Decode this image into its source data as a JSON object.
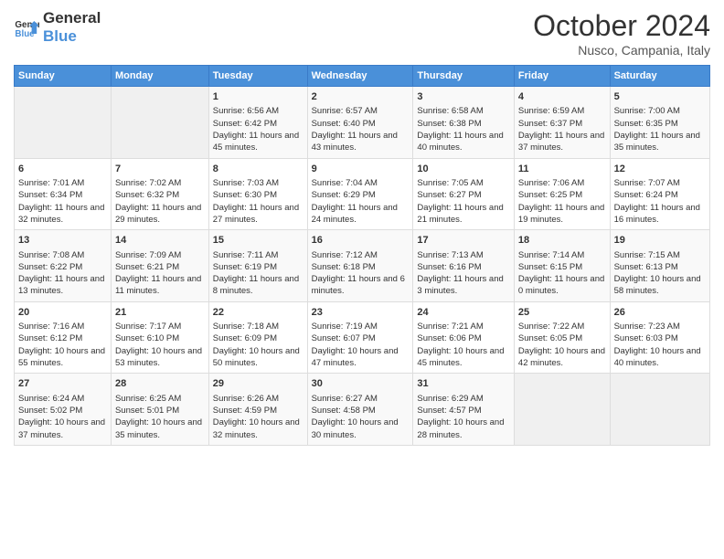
{
  "header": {
    "logo_line1": "General",
    "logo_line2": "Blue",
    "month": "October 2024",
    "location": "Nusco, Campania, Italy"
  },
  "weekdays": [
    "Sunday",
    "Monday",
    "Tuesday",
    "Wednesday",
    "Thursday",
    "Friday",
    "Saturday"
  ],
  "weeks": [
    [
      {
        "day": "",
        "sunrise": "",
        "sunset": "",
        "daylight": "",
        "empty": true
      },
      {
        "day": "",
        "sunrise": "",
        "sunset": "",
        "daylight": "",
        "empty": true
      },
      {
        "day": "1",
        "sunrise": "Sunrise: 6:56 AM",
        "sunset": "Sunset: 6:42 PM",
        "daylight": "Daylight: 11 hours and 45 minutes.",
        "empty": false
      },
      {
        "day": "2",
        "sunrise": "Sunrise: 6:57 AM",
        "sunset": "Sunset: 6:40 PM",
        "daylight": "Daylight: 11 hours and 43 minutes.",
        "empty": false
      },
      {
        "day": "3",
        "sunrise": "Sunrise: 6:58 AM",
        "sunset": "Sunset: 6:38 PM",
        "daylight": "Daylight: 11 hours and 40 minutes.",
        "empty": false
      },
      {
        "day": "4",
        "sunrise": "Sunrise: 6:59 AM",
        "sunset": "Sunset: 6:37 PM",
        "daylight": "Daylight: 11 hours and 37 minutes.",
        "empty": false
      },
      {
        "day": "5",
        "sunrise": "Sunrise: 7:00 AM",
        "sunset": "Sunset: 6:35 PM",
        "daylight": "Daylight: 11 hours and 35 minutes.",
        "empty": false
      }
    ],
    [
      {
        "day": "6",
        "sunrise": "Sunrise: 7:01 AM",
        "sunset": "Sunset: 6:34 PM",
        "daylight": "Daylight: 11 hours and 32 minutes.",
        "empty": false
      },
      {
        "day": "7",
        "sunrise": "Sunrise: 7:02 AM",
        "sunset": "Sunset: 6:32 PM",
        "daylight": "Daylight: 11 hours and 29 minutes.",
        "empty": false
      },
      {
        "day": "8",
        "sunrise": "Sunrise: 7:03 AM",
        "sunset": "Sunset: 6:30 PM",
        "daylight": "Daylight: 11 hours and 27 minutes.",
        "empty": false
      },
      {
        "day": "9",
        "sunrise": "Sunrise: 7:04 AM",
        "sunset": "Sunset: 6:29 PM",
        "daylight": "Daylight: 11 hours and 24 minutes.",
        "empty": false
      },
      {
        "day": "10",
        "sunrise": "Sunrise: 7:05 AM",
        "sunset": "Sunset: 6:27 PM",
        "daylight": "Daylight: 11 hours and 21 minutes.",
        "empty": false
      },
      {
        "day": "11",
        "sunrise": "Sunrise: 7:06 AM",
        "sunset": "Sunset: 6:25 PM",
        "daylight": "Daylight: 11 hours and 19 minutes.",
        "empty": false
      },
      {
        "day": "12",
        "sunrise": "Sunrise: 7:07 AM",
        "sunset": "Sunset: 6:24 PM",
        "daylight": "Daylight: 11 hours and 16 minutes.",
        "empty": false
      }
    ],
    [
      {
        "day": "13",
        "sunrise": "Sunrise: 7:08 AM",
        "sunset": "Sunset: 6:22 PM",
        "daylight": "Daylight: 11 hours and 13 minutes.",
        "empty": false
      },
      {
        "day": "14",
        "sunrise": "Sunrise: 7:09 AM",
        "sunset": "Sunset: 6:21 PM",
        "daylight": "Daylight: 11 hours and 11 minutes.",
        "empty": false
      },
      {
        "day": "15",
        "sunrise": "Sunrise: 7:11 AM",
        "sunset": "Sunset: 6:19 PM",
        "daylight": "Daylight: 11 hours and 8 minutes.",
        "empty": false
      },
      {
        "day": "16",
        "sunrise": "Sunrise: 7:12 AM",
        "sunset": "Sunset: 6:18 PM",
        "daylight": "Daylight: 11 hours and 6 minutes.",
        "empty": false
      },
      {
        "day": "17",
        "sunrise": "Sunrise: 7:13 AM",
        "sunset": "Sunset: 6:16 PM",
        "daylight": "Daylight: 11 hours and 3 minutes.",
        "empty": false
      },
      {
        "day": "18",
        "sunrise": "Sunrise: 7:14 AM",
        "sunset": "Sunset: 6:15 PM",
        "daylight": "Daylight: 11 hours and 0 minutes.",
        "empty": false
      },
      {
        "day": "19",
        "sunrise": "Sunrise: 7:15 AM",
        "sunset": "Sunset: 6:13 PM",
        "daylight": "Daylight: 10 hours and 58 minutes.",
        "empty": false
      }
    ],
    [
      {
        "day": "20",
        "sunrise": "Sunrise: 7:16 AM",
        "sunset": "Sunset: 6:12 PM",
        "daylight": "Daylight: 10 hours and 55 minutes.",
        "empty": false
      },
      {
        "day": "21",
        "sunrise": "Sunrise: 7:17 AM",
        "sunset": "Sunset: 6:10 PM",
        "daylight": "Daylight: 10 hours and 53 minutes.",
        "empty": false
      },
      {
        "day": "22",
        "sunrise": "Sunrise: 7:18 AM",
        "sunset": "Sunset: 6:09 PM",
        "daylight": "Daylight: 10 hours and 50 minutes.",
        "empty": false
      },
      {
        "day": "23",
        "sunrise": "Sunrise: 7:19 AM",
        "sunset": "Sunset: 6:07 PM",
        "daylight": "Daylight: 10 hours and 47 minutes.",
        "empty": false
      },
      {
        "day": "24",
        "sunrise": "Sunrise: 7:21 AM",
        "sunset": "Sunset: 6:06 PM",
        "daylight": "Daylight: 10 hours and 45 minutes.",
        "empty": false
      },
      {
        "day": "25",
        "sunrise": "Sunrise: 7:22 AM",
        "sunset": "Sunset: 6:05 PM",
        "daylight": "Daylight: 10 hours and 42 minutes.",
        "empty": false
      },
      {
        "day": "26",
        "sunrise": "Sunrise: 7:23 AM",
        "sunset": "Sunset: 6:03 PM",
        "daylight": "Daylight: 10 hours and 40 minutes.",
        "empty": false
      }
    ],
    [
      {
        "day": "27",
        "sunrise": "Sunrise: 6:24 AM",
        "sunset": "Sunset: 5:02 PM",
        "daylight": "Daylight: 10 hours and 37 minutes.",
        "empty": false
      },
      {
        "day": "28",
        "sunrise": "Sunrise: 6:25 AM",
        "sunset": "Sunset: 5:01 PM",
        "daylight": "Daylight: 10 hours and 35 minutes.",
        "empty": false
      },
      {
        "day": "29",
        "sunrise": "Sunrise: 6:26 AM",
        "sunset": "Sunset: 4:59 PM",
        "daylight": "Daylight: 10 hours and 32 minutes.",
        "empty": false
      },
      {
        "day": "30",
        "sunrise": "Sunrise: 6:27 AM",
        "sunset": "Sunset: 4:58 PM",
        "daylight": "Daylight: 10 hours and 30 minutes.",
        "empty": false
      },
      {
        "day": "31",
        "sunrise": "Sunrise: 6:29 AM",
        "sunset": "Sunset: 4:57 PM",
        "daylight": "Daylight: 10 hours and 28 minutes.",
        "empty": false
      },
      {
        "day": "",
        "sunrise": "",
        "sunset": "",
        "daylight": "",
        "empty": true
      },
      {
        "day": "",
        "sunrise": "",
        "sunset": "",
        "daylight": "",
        "empty": true
      }
    ]
  ]
}
